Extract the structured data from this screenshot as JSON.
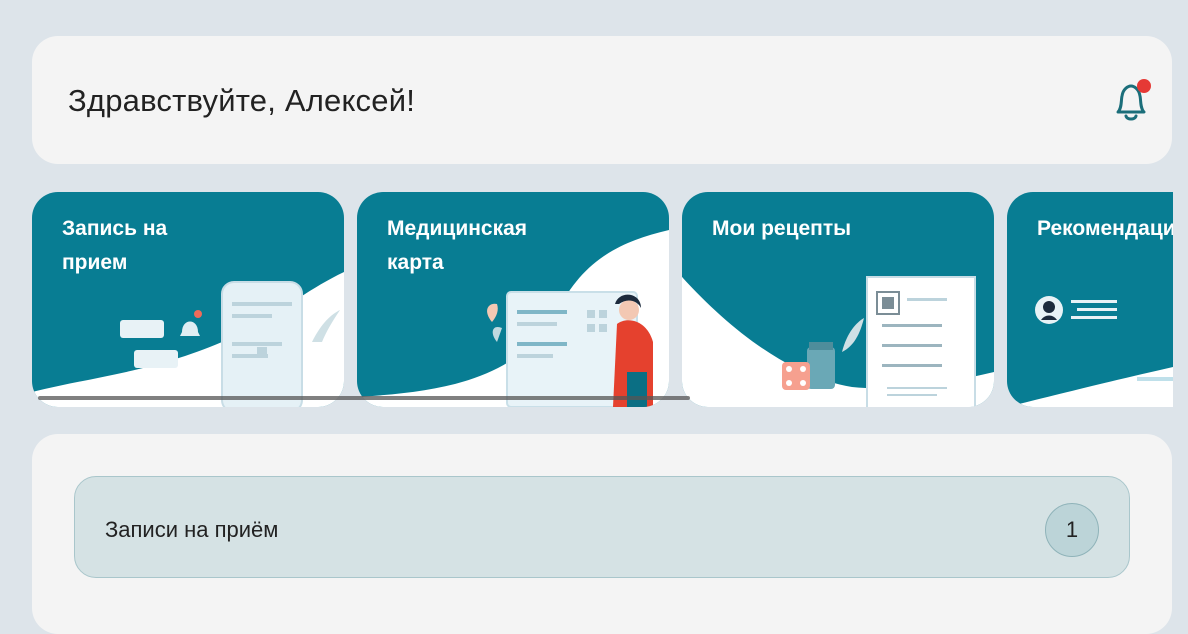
{
  "header": {
    "greeting": "Здравствуйте, Алексей!",
    "notification_icon": "bell-icon",
    "notification_dot_color": "#e53935"
  },
  "tiles": [
    {
      "title": "Запись на\nприем",
      "icon": "phone-calendar-illustration"
    },
    {
      "title": "Медицинская\nкарта",
      "icon": "doctor-board-illustration"
    },
    {
      "title": "Мои рецепты",
      "icon": "prescription-illustration"
    },
    {
      "title": "Рекомендации",
      "icon": "recommendations-illustration"
    }
  ],
  "appointments": {
    "label": "Записи на приём",
    "count": "1"
  },
  "colors": {
    "tile_bg": "#087d93",
    "accent": "#087d93",
    "page_bg": "#dde4ea"
  }
}
